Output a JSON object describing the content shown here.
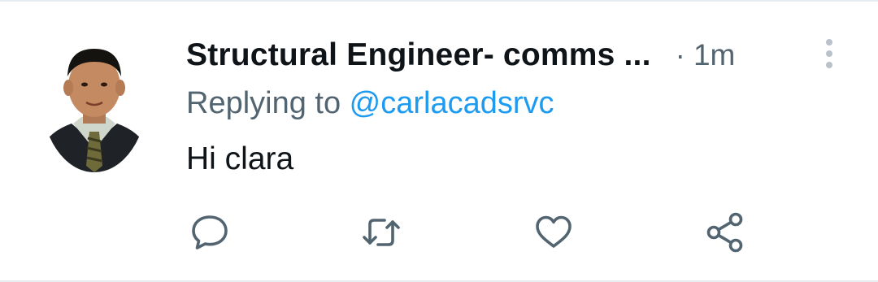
{
  "tweet": {
    "author_name": "Structural Engineer- comms ...",
    "separator": "·",
    "timestamp": "1m",
    "reply_prefix": "Replying to ",
    "reply_handle": "@carlacadsrvc",
    "text": "Hi clara"
  },
  "actions": [
    {
      "name": "reply",
      "icon": "comment-bubble-icon"
    },
    {
      "name": "retweet",
      "icon": "retweet-arrows-icon"
    },
    {
      "name": "like",
      "icon": "heart-icon"
    },
    {
      "name": "share",
      "icon": "share-nodes-icon"
    }
  ],
  "colors": {
    "text_primary": "#0f1419",
    "text_secondary": "#536471",
    "link": "#1d9bf0",
    "divider": "#e6ecf0",
    "more_dots": "#b9c2ca"
  }
}
